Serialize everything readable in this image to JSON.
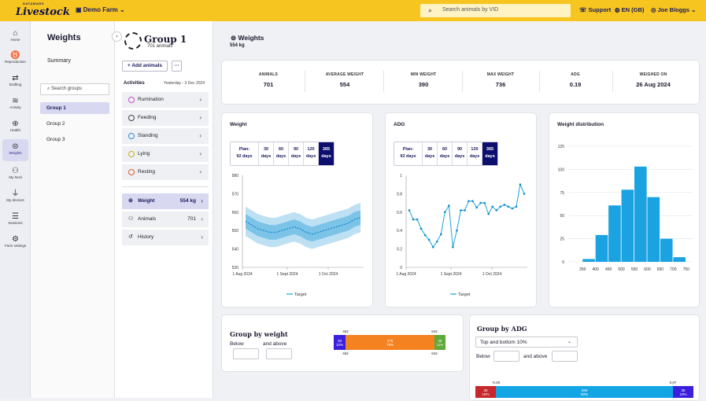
{
  "topbar": {
    "brand_small": "DATAMARS",
    "brand": "Livestock",
    "farm": "Demo Farm",
    "search_placeholder": "Search animals by VID",
    "support": "Support",
    "language": "EN (GB)",
    "user": "Joe Bloggs"
  },
  "nav": [
    {
      "label": "Home",
      "icon": "home-icon"
    },
    {
      "label": "Reproduction",
      "icon": "reproduction-icon"
    },
    {
      "label": "Drafting",
      "icon": "drafting-icon"
    },
    {
      "label": "Activity",
      "icon": "activity-icon"
    },
    {
      "label": "Health",
      "icon": "health-icon"
    },
    {
      "label": "Weights",
      "icon": "scale-icon"
    },
    {
      "label": "My herd",
      "icon": "herd-icon"
    },
    {
      "label": "My devices",
      "icon": "devices-icon"
    },
    {
      "label": "Sessions",
      "icon": "sessions-icon"
    },
    {
      "label": "Farm settings",
      "icon": "settings-icon"
    }
  ],
  "weights_panel": {
    "title": "Weights",
    "summary": "Summary",
    "search_placeholder": "Search groups",
    "groups": [
      "Group 1",
      "Group 2",
      "Group 3"
    ]
  },
  "group": {
    "name": "Group 1",
    "count": "701 animals",
    "add_animals": "+ Add animals",
    "more": "···",
    "activities_label": "Activities",
    "activities_date": "Yesterday - 3 Dec 2024",
    "activities": [
      {
        "label": "Rumination",
        "color": "#c04fc8"
      },
      {
        "label": "Feeding",
        "color": "#444"
      },
      {
        "label": "Standing",
        "color": "#2d8cd6"
      },
      {
        "label": "Lying",
        "color": "#c7b21d"
      },
      {
        "label": "Resting",
        "color": "#e05a2a"
      }
    ],
    "rows": [
      {
        "label": "Weight",
        "value": "554 kg"
      },
      {
        "label": "Animals",
        "value": "701"
      },
      {
        "label": "History",
        "value": ""
      }
    ]
  },
  "main": {
    "title": "Weights",
    "subtitle": "554 kg",
    "stats": [
      {
        "label": "ANIMALS",
        "value": "701"
      },
      {
        "label": "AVERAGE WEIGHT",
        "value": "554"
      },
      {
        "label": "MIN WEIGHT",
        "value": "390"
      },
      {
        "label": "MAX WEIGHT",
        "value": "736"
      },
      {
        "label": "ADG",
        "value": "0.19"
      },
      {
        "label": "WEIGHED ON",
        "value": "26 Aug 2024"
      }
    ],
    "weight_card": {
      "title": "Weight",
      "legend": "Target"
    },
    "adg_card": {
      "title": "ADG",
      "legend": "Target"
    },
    "dist_card": {
      "title": "Weight distribution"
    },
    "period_buttons": [
      [
        "Plan:",
        "92 days"
      ],
      [
        "30",
        "days"
      ],
      [
        "60",
        "days"
      ],
      [
        "90",
        "days"
      ],
      [
        "120",
        "days"
      ],
      [
        "365",
        "days"
      ]
    ],
    "group_by_weight": {
      "title": "Group by weight",
      "below": "Below",
      "above": "and above",
      "bar": {
        "left_count": "39",
        "left_pct": "10%",
        "mid_count": "278",
        "mid_pct": "79%",
        "right_count": "38",
        "right_pct": "11%",
        "low_mark": "462",
        "high_mark": "642"
      }
    },
    "group_by_adg": {
      "title": "Group by ADG",
      "select": "Top and bottom 10%",
      "below": "Below",
      "above": "and above",
      "bar": {
        "left_count": "38",
        "left_pct": "10%",
        "mid_count": "296",
        "mid_pct": "80%",
        "right_count": "38",
        "right_pct": "10%",
        "low_mark": "-0.49",
        "high_mark": "0.87"
      }
    }
  },
  "chart_data": [
    {
      "type": "line",
      "title": "Weight",
      "ylim": [
        530,
        580
      ],
      "yticks": [
        530,
        540,
        550,
        560,
        570,
        580
      ],
      "xticks": [
        "1 Aug 2024",
        "1 Sept 2024",
        "1 Oct 2024"
      ],
      "series": [
        {
          "name": "Target",
          "values": [
            555,
            553,
            551,
            550,
            549,
            549,
            550,
            551,
            552,
            551,
            549,
            548,
            549,
            550,
            551,
            552,
            553,
            554,
            556,
            557
          ]
        }
      ]
    },
    {
      "type": "line",
      "title": "ADG",
      "ylim": [
        0,
        1
      ],
      "yticks": [
        0,
        0.2,
        0.4,
        0.6,
        0.8,
        1
      ],
      "xticks": [
        "1 Aug 2024",
        "1 Sept 2024",
        "1 Oct 2024"
      ],
      "series": [
        {
          "name": "Target",
          "values": [
            0.62,
            0.52,
            0.52,
            0.42,
            0.35,
            0.3,
            0.22,
            0.28,
            0.36,
            0.6,
            0.67,
            0.22,
            0.4,
            0.62,
            0.62,
            0.72,
            0.72,
            0.65,
            0.7,
            0.7,
            0.58,
            0.66,
            0.62,
            0.66,
            0.68,
            0.66,
            0.64,
            0.66,
            0.9,
            0.8
          ]
        }
      ]
    },
    {
      "type": "bar",
      "title": "Weight distribution",
      "categories": [
        "350",
        "400",
        "450",
        "500",
        "550",
        "600",
        "650",
        "700",
        "750"
      ],
      "values": [
        3,
        29,
        61,
        78,
        103,
        70,
        25,
        5,
        0
      ],
      "ylim": [
        0,
        125
      ],
      "yticks": [
        0,
        25,
        50,
        75,
        100,
        125
      ]
    }
  ]
}
